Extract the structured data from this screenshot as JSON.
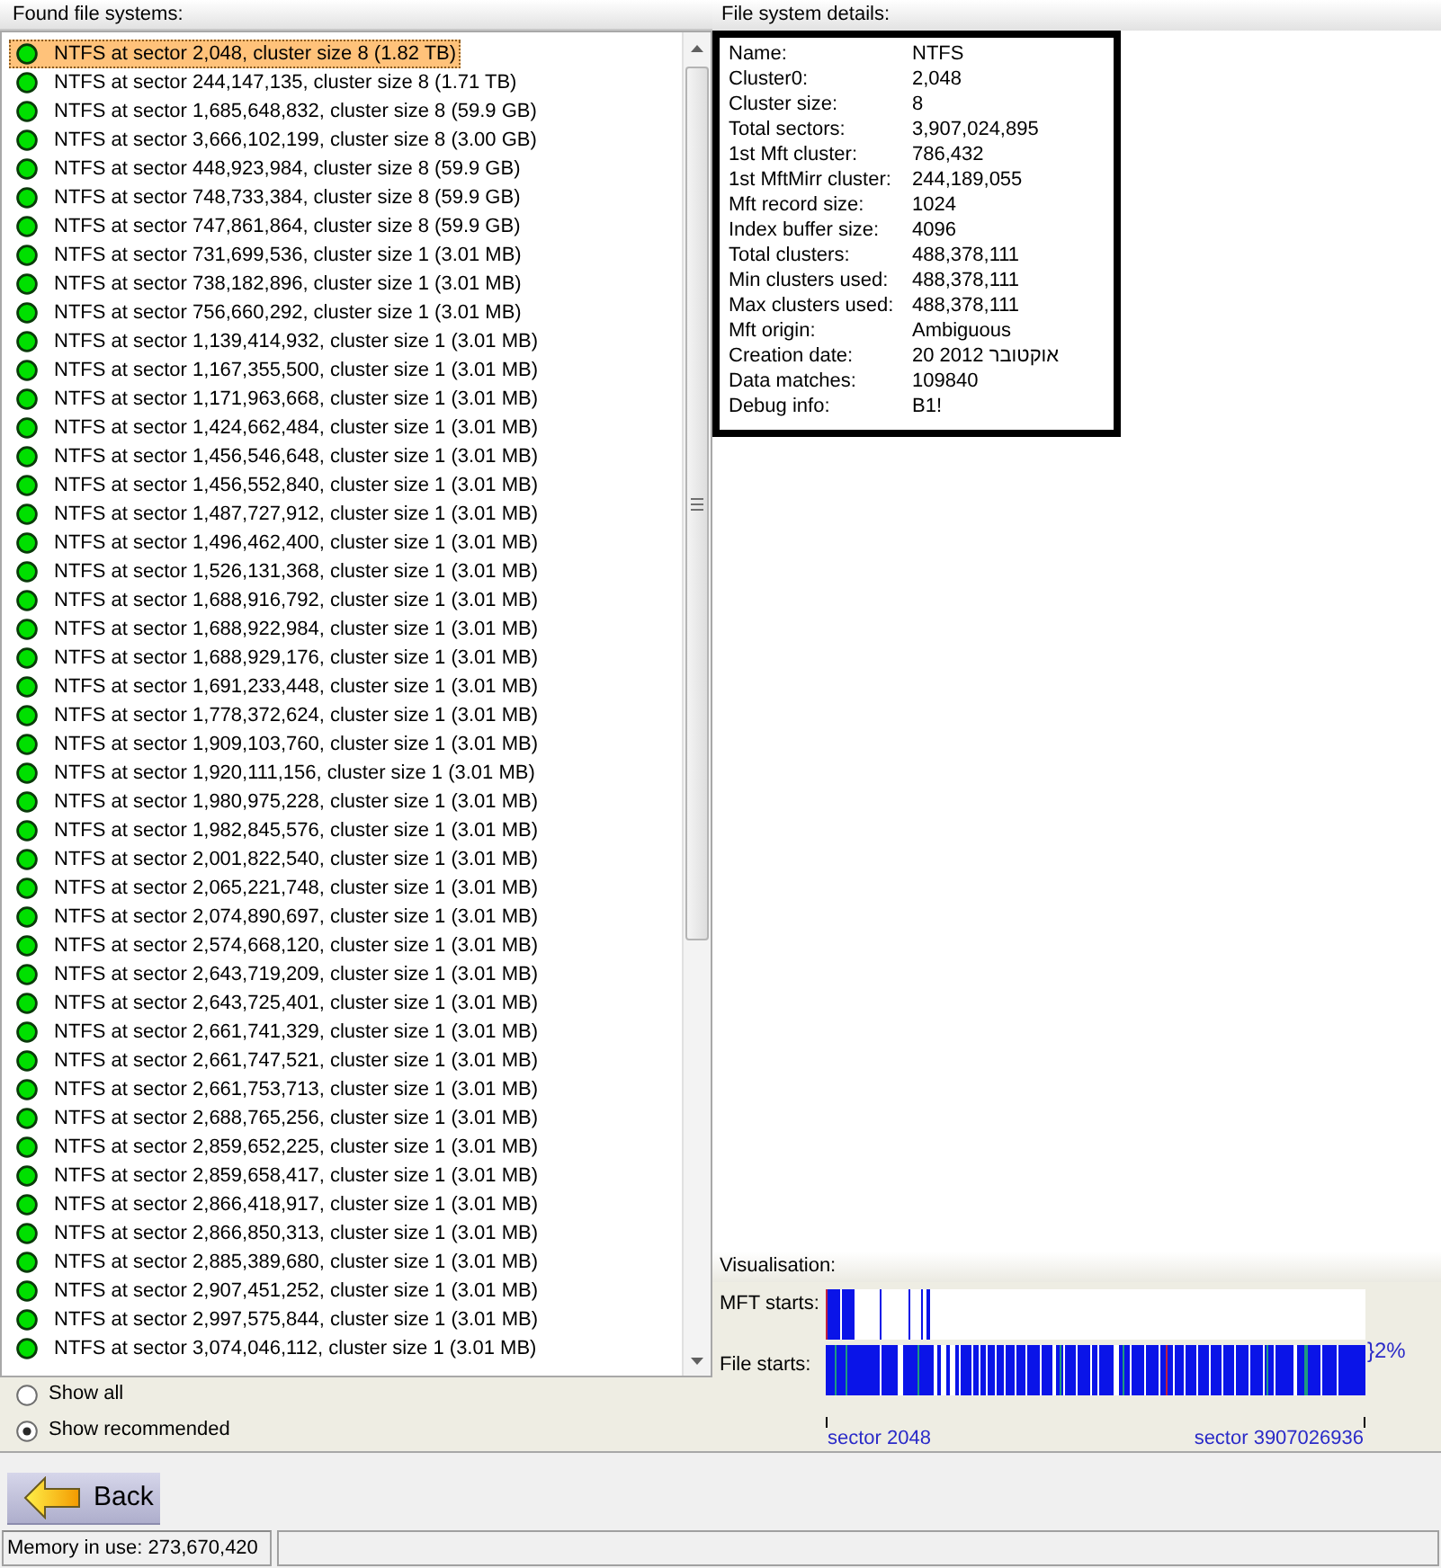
{
  "found_systems": {
    "title": "Found file systems:",
    "items": [
      {
        "label": "NTFS at sector 2,048, cluster size 8 (1.82 TB)",
        "selected": true
      },
      {
        "label": "NTFS at sector 244,147,135, cluster size 8 (1.71 TB)",
        "selected": false
      },
      {
        "label": "NTFS at sector 1,685,648,832, cluster size 8 (59.9 GB)",
        "selected": false
      },
      {
        "label": "NTFS at sector 3,666,102,199, cluster size 8 (3.00 GB)",
        "selected": false
      },
      {
        "label": "NTFS at sector 448,923,984, cluster size 8 (59.9 GB)",
        "selected": false
      },
      {
        "label": "NTFS at sector 748,733,384, cluster size 8 (59.9 GB)",
        "selected": false
      },
      {
        "label": "NTFS at sector 747,861,864, cluster size 8 (59.9 GB)",
        "selected": false
      },
      {
        "label": "NTFS at sector 731,699,536, cluster size 1 (3.01 MB)",
        "selected": false
      },
      {
        "label": "NTFS at sector 738,182,896, cluster size 1 (3.01 MB)",
        "selected": false
      },
      {
        "label": "NTFS at sector 756,660,292, cluster size 1 (3.01 MB)",
        "selected": false
      },
      {
        "label": "NTFS at sector 1,139,414,932, cluster size 1 (3.01 MB)",
        "selected": false
      },
      {
        "label": "NTFS at sector 1,167,355,500, cluster size 1 (3.01 MB)",
        "selected": false
      },
      {
        "label": "NTFS at sector 1,171,963,668, cluster size 1 (3.01 MB)",
        "selected": false
      },
      {
        "label": "NTFS at sector 1,424,662,484, cluster size 1 (3.01 MB)",
        "selected": false
      },
      {
        "label": "NTFS at sector 1,456,546,648, cluster size 1 (3.01 MB)",
        "selected": false
      },
      {
        "label": "NTFS at sector 1,456,552,840, cluster size 1 (3.01 MB)",
        "selected": false
      },
      {
        "label": "NTFS at sector 1,487,727,912, cluster size 1 (3.01 MB)",
        "selected": false
      },
      {
        "label": "NTFS at sector 1,496,462,400, cluster size 1 (3.01 MB)",
        "selected": false
      },
      {
        "label": "NTFS at sector 1,526,131,368, cluster size 1 (3.01 MB)",
        "selected": false
      },
      {
        "label": "NTFS at sector 1,688,916,792, cluster size 1 (3.01 MB)",
        "selected": false
      },
      {
        "label": "NTFS at sector 1,688,922,984, cluster size 1 (3.01 MB)",
        "selected": false
      },
      {
        "label": "NTFS at sector 1,688,929,176, cluster size 1 (3.01 MB)",
        "selected": false
      },
      {
        "label": "NTFS at sector 1,691,233,448, cluster size 1 (3.01 MB)",
        "selected": false
      },
      {
        "label": "NTFS at sector 1,778,372,624, cluster size 1 (3.01 MB)",
        "selected": false
      },
      {
        "label": "NTFS at sector 1,909,103,760, cluster size 1 (3.01 MB)",
        "selected": false
      },
      {
        "label": "NTFS at sector 1,920,111,156, cluster size 1 (3.01 MB)",
        "selected": false
      },
      {
        "label": "NTFS at sector 1,980,975,228, cluster size 1 (3.01 MB)",
        "selected": false
      },
      {
        "label": "NTFS at sector 1,982,845,576, cluster size 1 (3.01 MB)",
        "selected": false
      },
      {
        "label": "NTFS at sector 2,001,822,540, cluster size 1 (3.01 MB)",
        "selected": false
      },
      {
        "label": "NTFS at sector 2,065,221,748, cluster size 1 (3.01 MB)",
        "selected": false
      },
      {
        "label": "NTFS at sector 2,074,890,697, cluster size 1 (3.01 MB)",
        "selected": false
      },
      {
        "label": "NTFS at sector 2,574,668,120, cluster size 1 (3.01 MB)",
        "selected": false
      },
      {
        "label": "NTFS at sector 2,643,719,209, cluster size 1 (3.01 MB)",
        "selected": false
      },
      {
        "label": "NTFS at sector 2,643,725,401, cluster size 1 (3.01 MB)",
        "selected": false
      },
      {
        "label": "NTFS at sector 2,661,741,329, cluster size 1 (3.01 MB)",
        "selected": false
      },
      {
        "label": "NTFS at sector 2,661,747,521, cluster size 1 (3.01 MB)",
        "selected": false
      },
      {
        "label": "NTFS at sector 2,661,753,713, cluster size 1 (3.01 MB)",
        "selected": false
      },
      {
        "label": "NTFS at sector 2,688,765,256, cluster size 1 (3.01 MB)",
        "selected": false
      },
      {
        "label": "NTFS at sector 2,859,652,225, cluster size 1 (3.01 MB)",
        "selected": false
      },
      {
        "label": "NTFS at sector 2,859,658,417, cluster size 1 (3.01 MB)",
        "selected": false
      },
      {
        "label": "NTFS at sector 2,866,418,917, cluster size 1 (3.01 MB)",
        "selected": false
      },
      {
        "label": "NTFS at sector 2,866,850,313, cluster size 1 (3.01 MB)",
        "selected": false
      },
      {
        "label": "NTFS at sector 2,885,389,680, cluster size 1 (3.01 MB)",
        "selected": false
      },
      {
        "label": "NTFS at sector 2,907,451,252, cluster size 1 (3.01 MB)",
        "selected": false
      },
      {
        "label": "NTFS at sector 2,997,575,844, cluster size 1 (3.01 MB)",
        "selected": false
      },
      {
        "label": "NTFS at sector 3,074,046,112, cluster size 1 (3.01 MB)",
        "selected": false
      }
    ]
  },
  "filter_options": [
    {
      "label": "Show all",
      "selected": false
    },
    {
      "label": "Show recommended",
      "selected": true
    }
  ],
  "details": {
    "title": "File system details:",
    "fields": [
      {
        "label": "Name:",
        "value": "NTFS"
      },
      {
        "label": "Cluster0:",
        "value": "2,048"
      },
      {
        "label": "Cluster size:",
        "value": "8"
      },
      {
        "label": "Total sectors:",
        "value": "3,907,024,895"
      },
      {
        "label": "1st Mft cluster:",
        "value": "786,432"
      },
      {
        "label": "1st MftMirr cluster:",
        "value": "244,189,055"
      },
      {
        "label": "Mft record size:",
        "value": "1024"
      },
      {
        "label": "Index buffer size:",
        "value": "4096"
      },
      {
        "label": "Total clusters:",
        "value": "488,378,111"
      },
      {
        "label": "Min clusters used:",
        "value": "488,378,111"
      },
      {
        "label": "Max clusters used:",
        "value": "488,378,111"
      },
      {
        "label": "Mft origin:",
        "value": "Ambiguous"
      },
      {
        "label": "Creation date:",
        "value": "20 2012 אוקטובר"
      },
      {
        "label": "Data matches:",
        "value": "109840"
      },
      {
        "label": "Debug info:",
        "value": "B1!"
      }
    ]
  },
  "visualisation": {
    "title": "Visualisation:",
    "rows": [
      {
        "kind": "mft",
        "label": "MFT starts:"
      },
      {
        "kind": "file",
        "label": "File starts:"
      }
    ],
    "share_label": "}2%",
    "start_label": "sector 2048",
    "end_label": "sector 3907026936"
  },
  "back_button": {
    "label": "Back"
  },
  "status_bar": {
    "memory": "Memory in use: 273,670,420"
  }
}
